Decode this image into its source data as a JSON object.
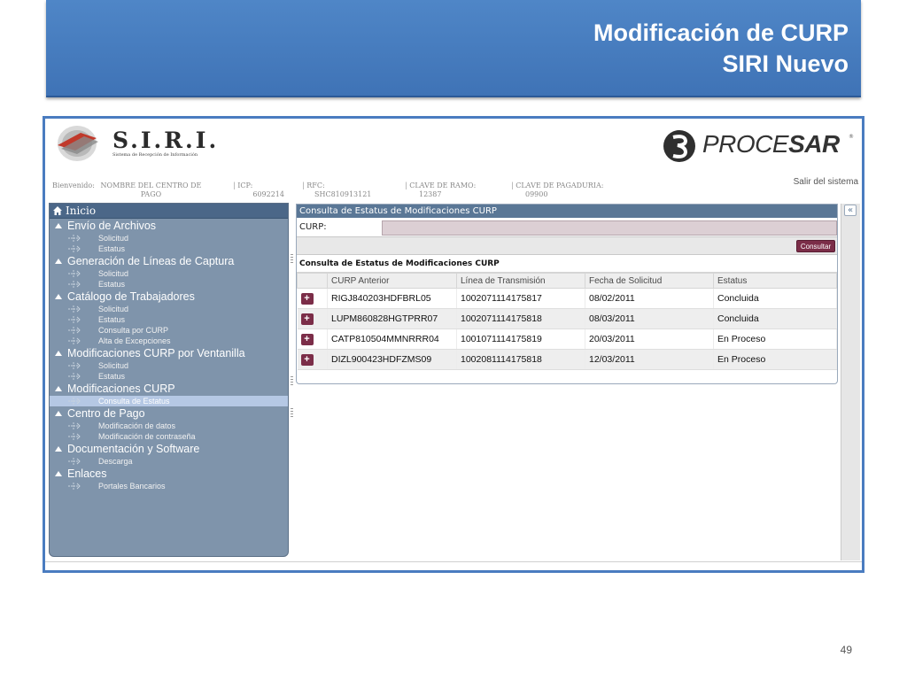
{
  "slide": {
    "title_line1": "Modificación de CURP",
    "title_line2": "SIRI Nuevo",
    "page_number": "49"
  },
  "app": {
    "logo_title": "S.I.R.I.",
    "logo_subtitle": "Sistema de Recepción de Información",
    "procesar_prefix": "PROCE",
    "procesar_suffix": "SAR",
    "procesar_reg": "®",
    "logout": "Salir del sistema",
    "info": {
      "welcome_label": "Bienvenido:",
      "welcome_value": "NOMBRE DEL CENTRO DE PAGO",
      "icp_label": "ICP:",
      "icp_value": "6092214",
      "rfc_label": "RFC:",
      "rfc_value": "SHC810913121",
      "ramo_label": "CLAVE DE RAMO:",
      "ramo_value": "12387",
      "pagaduria_label": "CLAVE DE PAGADURIA:",
      "pagaduria_value": "09900"
    }
  },
  "sidebar": {
    "home": "Inicio",
    "sections": [
      {
        "label": "Envío de Archivos",
        "items": [
          "Solicitud",
          "Estatus"
        ]
      },
      {
        "label": "Generación de Líneas de Captura",
        "items": [
          "Solicitud",
          "Estatus"
        ]
      },
      {
        "label": "Catálogo de Trabajadores",
        "items": [
          "Solicitud",
          "Estatus",
          "Consulta por CURP",
          "Alta de Excepciones"
        ]
      },
      {
        "label": "Modificaciones CURP por Ventanilla",
        "items": [
          "Solicitud",
          "Estatus"
        ]
      },
      {
        "label": "Modificaciones CURP",
        "items": [
          "Consulta de Estatus"
        ]
      },
      {
        "label": "Centro de Pago",
        "items": [
          "Modificación de datos",
          "Modificación de contraseña"
        ]
      },
      {
        "label": "Documentación y Software",
        "items": [
          "Descarga"
        ]
      },
      {
        "label": "Enlaces",
        "items": [
          "Portales Bancarios"
        ]
      }
    ]
  },
  "main": {
    "panel_title": "Consulta de Estatus de Modificaciones CURP",
    "curp_label": "CURP:",
    "curp_value": "",
    "consultar_label": "Consultar",
    "results_title": "Consulta de Estatus de Modificaciones CURP",
    "columns": [
      "CURP Anterior",
      "Línea de Transmisión",
      "Fecha de Solicitud",
      "Estatus"
    ],
    "rows": [
      {
        "curp": "RIGJ840203HDFBRL05",
        "linea": "1002071114175817",
        "fecha": "08/02/2011",
        "estatus": "Concluida"
      },
      {
        "curp": "LUPM860828HGTPRR07",
        "linea": "1002071114175818",
        "fecha": "08/03/2011",
        "estatus": "Concluida"
      },
      {
        "curp": "CATP810504MMNRRR04",
        "linea": "1001071114175819",
        "fecha": "20/03/2011",
        "estatus": "En Proceso"
      },
      {
        "curp": "DIZL900423HDFZMS09",
        "linea": "1002081114175818",
        "fecha": "12/03/2011",
        "estatus": "En Proceso"
      }
    ],
    "expand_symbol": "+",
    "collapse_symbol": "«"
  },
  "colors": {
    "banner": "#4f86c7",
    "sidebar": "#7f94ab",
    "accent_button": "#7b2d48",
    "panel_header": "#5a7796"
  }
}
